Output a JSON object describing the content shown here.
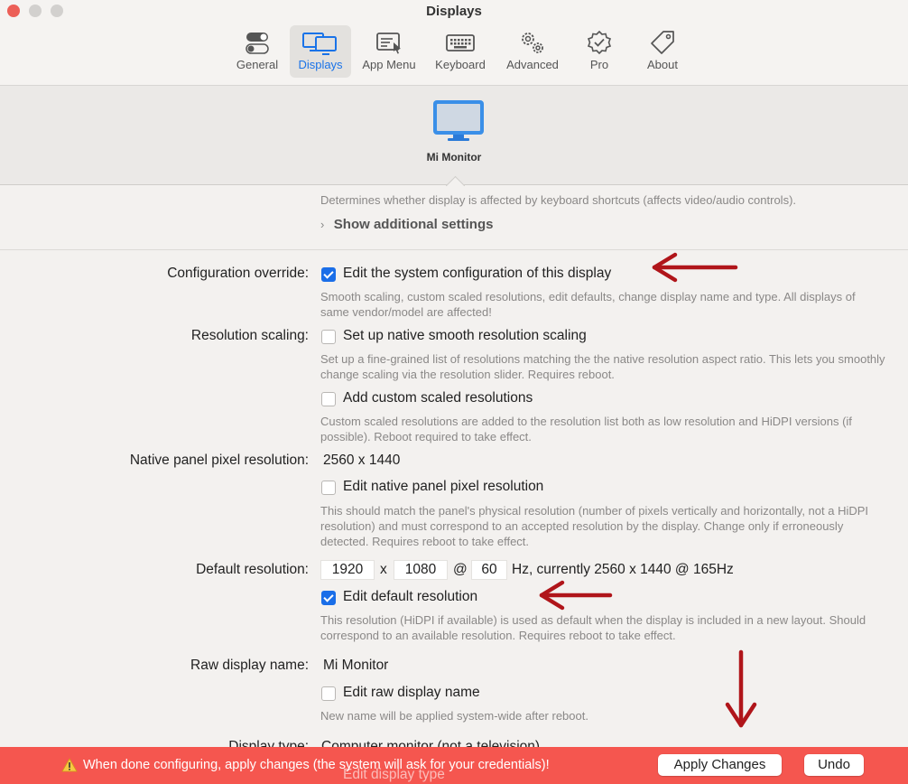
{
  "window": {
    "title": "Displays"
  },
  "toolbar": [
    {
      "label": "General",
      "icon": "toggle-switches-icon"
    },
    {
      "label": "Displays",
      "icon": "displays-icon",
      "active": true
    },
    {
      "label": "App Menu",
      "icon": "app-menu-icon"
    },
    {
      "label": "Keyboard",
      "icon": "keyboard-icon"
    },
    {
      "label": "Advanced",
      "icon": "gears-icon"
    },
    {
      "label": "Pro",
      "icon": "verified-badge-icon"
    },
    {
      "label": "About",
      "icon": "tag-icon"
    }
  ],
  "display": {
    "name": "Mi Monitor",
    "icon": "monitor-icon"
  },
  "settings": {
    "keyboard_help": "Determines whether display is affected by keyboard shortcuts (affects video/audio controls).",
    "show_additional": "Show additional settings",
    "config_override": {
      "label": "Configuration override:",
      "option": "Edit the system configuration of this display",
      "checked": true,
      "help": "Smooth scaling, custom scaled resolutions, edit defaults, change display name and type. All displays of same vendor/model are affected!"
    },
    "resolution_scaling": {
      "label": "Resolution scaling:",
      "option1": "Set up native smooth resolution scaling",
      "help1": "Set up a fine-grained list of resolutions matching the the native resolution aspect ratio. This lets you smoothly change scaling via the resolution slider. Requires reboot.",
      "option2": "Add custom scaled resolutions",
      "help2": "Custom scaled resolutions are added to the resolution list both as low resolution and HiDPI versions (if possible). Reboot required to take effect."
    },
    "native_panel": {
      "label": "Native panel pixel resolution:",
      "value": "2560 x 1440",
      "option": "Edit native panel pixel resolution",
      "help": "This should match the panel's physical resolution (number of pixels vertically and horizontally, not a HiDPI resolution) and must correspond to an accepted resolution by the display. Change only if erroneously detected. Requires reboot to take effect."
    },
    "default_resolution": {
      "label": "Default resolution:",
      "width": "1920",
      "x_sep": "x",
      "height": "1080",
      "at_sep": "@",
      "hz": "60",
      "suffix": "Hz, currently 2560 x 1440 @ 165Hz",
      "option": "Edit default resolution",
      "checked": true,
      "help": "This resolution (HiDPI if available) is used as default when the display is included in a new layout. Should correspond to an available resolution. Requires reboot to take effect."
    },
    "raw_name": {
      "label": "Raw display name:",
      "value": "Mi Monitor",
      "option": "Edit raw display name",
      "help": "New name will be applied system-wide after reboot."
    },
    "display_type": {
      "label": "Display type:",
      "value": "Computer monitor (not a television)",
      "option": "Edit display type"
    }
  },
  "bottom_bar": {
    "warning": "When done configuring, apply changes (the system will ask for your credentials)!",
    "apply": "Apply Changes",
    "undo": "Undo",
    "color": "#f5564f"
  },
  "annotation_color": "#b0151a"
}
